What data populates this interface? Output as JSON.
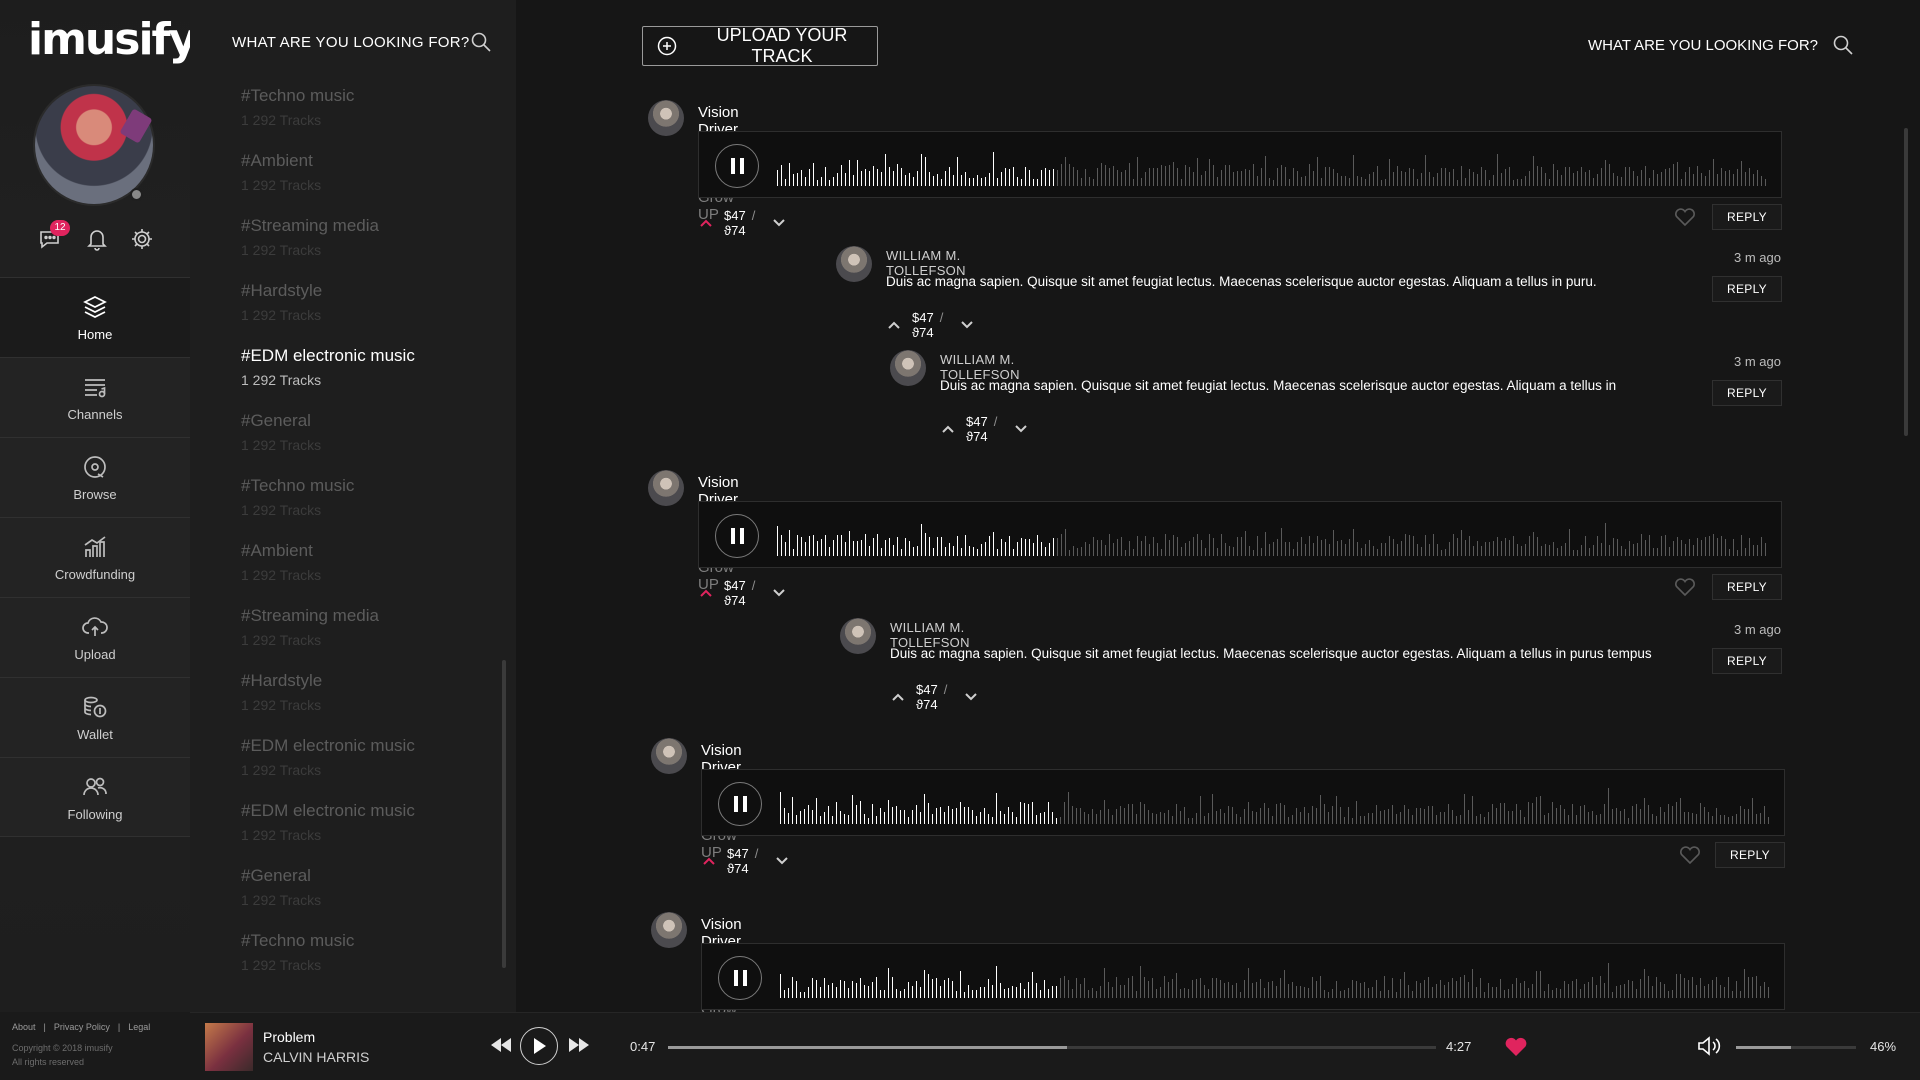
{
  "app": {
    "logo": "imusify"
  },
  "user": {
    "messages_badge": "12"
  },
  "nav": {
    "items": [
      {
        "label": "Home",
        "icon": "layers-icon",
        "active": true
      },
      {
        "label": "Channels",
        "icon": "channels-icon"
      },
      {
        "label": "Browse",
        "icon": "browse-icon"
      },
      {
        "label": "Crowdfunding",
        "icon": "crowdfunding-icon"
      },
      {
        "label": "Upload",
        "icon": "cloud-upload-icon"
      },
      {
        "label": "Wallet",
        "icon": "wallet-icon"
      },
      {
        "label": "Following",
        "icon": "following-icon"
      }
    ],
    "footer_links": [
      "About",
      "|",
      "Privacy Policy",
      "|",
      "Legal"
    ],
    "copyright": "Copyright © 2018 imusify",
    "rights": "All rights reserved"
  },
  "tags": {
    "search_label": "WHAT ARE YOU LOOKING FOR?",
    "items": [
      {
        "name": "#Techno music",
        "count": "1 292 Tracks"
      },
      {
        "name": "#Ambient",
        "count": "1 292 Tracks"
      },
      {
        "name": "#Streaming media",
        "count": "1 292 Tracks"
      },
      {
        "name": "#Hardstyle",
        "count": "1 292 Tracks"
      },
      {
        "name": "#EDM electronic music",
        "count": "1 292 Tracks",
        "active": true
      },
      {
        "name": "#General",
        "count": "1 292 Tracks"
      },
      {
        "name": "#Techno music",
        "count": "1 292 Tracks"
      },
      {
        "name": "#Ambient",
        "count": "1 292 Tracks"
      },
      {
        "name": "#Streaming media",
        "count": "1 292 Tracks"
      },
      {
        "name": "#Hardstyle",
        "count": "1 292 Tracks"
      },
      {
        "name": "#EDM electronic music",
        "count": "1 292 Tracks"
      },
      {
        "name": "#EDM electronic music",
        "count": "1 292 Tracks"
      },
      {
        "name": "#General",
        "count": "1 292 Tracks"
      },
      {
        "name": "#Techno music",
        "count": "1 292 Tracks"
      }
    ]
  },
  "main": {
    "upload_label": "UPLOAD YOUR TRACK",
    "search_label": "WHAT ARE YOU LOOKING FOR?",
    "posts": [
      {
        "artist": "Vision Driver",
        "sep": " - ",
        "track": "When I Grow UP",
        "up": "$47",
        "slash": "/",
        "down": "ϑ74",
        "reply": "REPLY",
        "comments": [
          {
            "name": "WILLIAM M. TOLLEFSON",
            "text": "Duis ac magna sapien. Quisque sit amet feugiat lectus. Maecenas scelerisque auctor egestas. Aliquam a tellus in puru.",
            "time": "3 m ago",
            "reply": "REPLY",
            "up": "$47",
            "slash": "/",
            "down": "ϑ74"
          },
          {
            "name": "WILLIAM M. TOLLEFSON",
            "text": "Duis ac magna sapien. Quisque sit amet feugiat lectus. Maecenas scelerisque auctor egestas. Aliquam a tellus in",
            "time": "3 m ago",
            "reply": "REPLY",
            "up": "$47",
            "slash": "/",
            "down": "ϑ74"
          }
        ]
      },
      {
        "artist": "Vision Driver",
        "sep": " - ",
        "track": "When I Grow UP",
        "up": "$47",
        "slash": "/",
        "down": "ϑ74",
        "reply": "REPLY",
        "comments": [
          {
            "name": "WILLIAM M. TOLLEFSON",
            "text": "Duis ac magna sapien. Quisque sit amet feugiat lectus. Maecenas scelerisque auctor egestas. Aliquam a tellus in purus tempus",
            "time": "3 m ago",
            "reply": "REPLY",
            "up": "$47",
            "slash": "/",
            "down": "ϑ74"
          }
        ]
      },
      {
        "artist": "Vision Driver",
        "sep": " - ",
        "track": "When I Grow UP",
        "up": "$47",
        "slash": "/",
        "down": "ϑ74",
        "reply": "REPLY",
        "comments": []
      },
      {
        "artist": "Vision Driver",
        "sep": " - ",
        "track": "When I Grow UP",
        "comments": []
      }
    ]
  },
  "player": {
    "title": "Problem",
    "artist": "CALVIN HARRIS",
    "time_current": "0:47",
    "time_total": "4:27",
    "progress": 0.52,
    "volume": 0.46,
    "volume_label": "46%",
    "accent": "#e0245e"
  }
}
